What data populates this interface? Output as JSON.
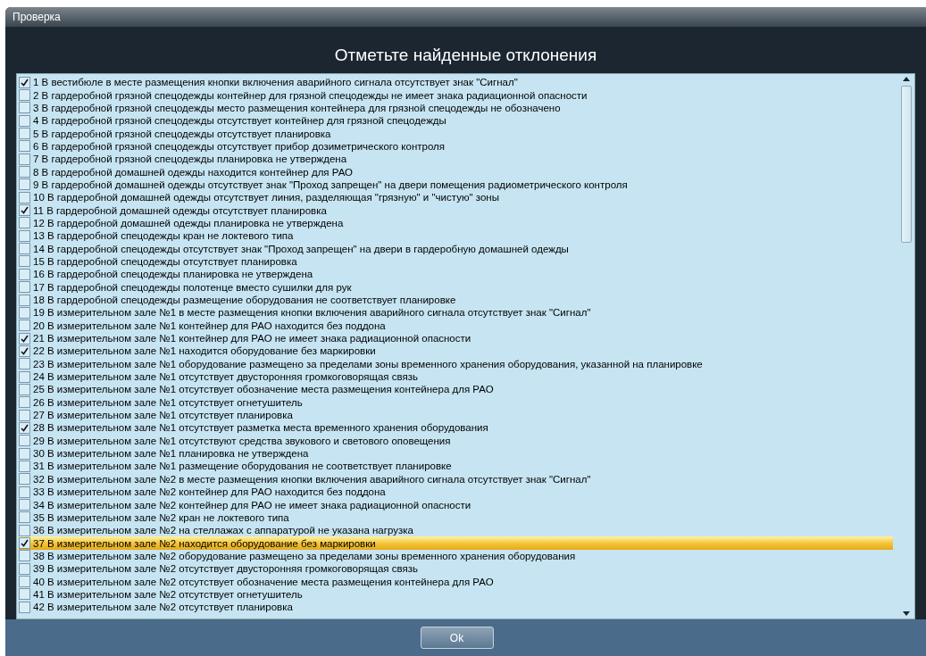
{
  "window": {
    "title": "Проверка"
  },
  "heading": "Отметьте найденные отклонения",
  "items": [
    {
      "label": "1 В вестибюле в месте размещения кнопки включения аварийного сигнала отсутствует знак \"Сигнал\"",
      "checked": true,
      "selected": false
    },
    {
      "label": "2 В гардеробной грязной спецодежды контейнер для грязной спецодежды не имеет знака радиационной опасности",
      "checked": false,
      "selected": false
    },
    {
      "label": "3 В гардеробной грязной спецодежды место размещения контейнера для грязной спецодежды не обозначено",
      "checked": false,
      "selected": false
    },
    {
      "label": "4 В гардеробной грязной спецодежды отсутствует контейнер для грязной спецодежды",
      "checked": false,
      "selected": false
    },
    {
      "label": "5 В гардеробной грязной спецодежды отсутствует планировка",
      "checked": false,
      "selected": false
    },
    {
      "label": "6 В гардеробной грязной спецодежды отсутствует прибор дозиметрического контроля",
      "checked": false,
      "selected": false
    },
    {
      "label": "7 В гардеробной грязной спецодежды планировка не утверждена",
      "checked": false,
      "selected": false
    },
    {
      "label": "8 В гардеробной домашней одежды находится контейнер для РАО",
      "checked": false,
      "selected": false
    },
    {
      "label": "9 В гардеробной домашней одежды отсутствует знак \"Проход запрещен\" на двери помещения радиометрического контроля",
      "checked": false,
      "selected": false
    },
    {
      "label": "10 В гардеробной домашней одежды отсутствует линия, разделяющая \"грязную\" и \"чистую\" зоны",
      "checked": false,
      "selected": false
    },
    {
      "label": "11 В гардеробной домашней одежды отсутствует планировка",
      "checked": true,
      "selected": false
    },
    {
      "label": "12 В гардеробной домашней одежды планировка не утверждена",
      "checked": false,
      "selected": false
    },
    {
      "label": "13 В гардеробной спецодежды кран не локтевого типа",
      "checked": false,
      "selected": false
    },
    {
      "label": "14 В гардеробной спецодежды отсутствует знак \"Проход запрещен\" на двери в гардеробную домашней одежды",
      "checked": false,
      "selected": false
    },
    {
      "label": "15 В гардеробной спецодежды отсутствует планировка",
      "checked": false,
      "selected": false
    },
    {
      "label": "16 В гардеробной спецодежды планировка не утверждена",
      "checked": false,
      "selected": false
    },
    {
      "label": "17 В гардеробной спецодежды полотенце вместо сушилки для рук",
      "checked": false,
      "selected": false
    },
    {
      "label": "18 В гардеробной спецодежды размещение оборудования не соответствует планировке",
      "checked": false,
      "selected": false
    },
    {
      "label": "19 В измерительном зале №1 в месте размещения кнопки включения аварийного сигнала отсутствует знак \"Сигнал\"",
      "checked": false,
      "selected": false
    },
    {
      "label": "20 В измерительном зале №1 контейнер для РАО находится без поддона",
      "checked": false,
      "selected": false
    },
    {
      "label": "21 В измерительном зале №1 контейнер для РАО не имеет знака радиационной опасности",
      "checked": true,
      "selected": false
    },
    {
      "label": "22 В измерительном зале №1 находится оборудование без маркировки",
      "checked": true,
      "selected": false
    },
    {
      "label": "23 В измерительном зале №1 оборудование размещено за пределами зоны временного хранения оборудования, указанной на планировке",
      "checked": false,
      "selected": false
    },
    {
      "label": "24 В измерительном зале №1 отсутствует двусторонняя громкоговорящая связь",
      "checked": false,
      "selected": false
    },
    {
      "label": "25 В измерительном зале №1 отсутствует обозначение места размещения контейнера для РАО",
      "checked": false,
      "selected": false
    },
    {
      "label": "26 В измерительном зале №1 отсутствует огнетушитель",
      "checked": false,
      "selected": false
    },
    {
      "label": "27 В измерительном зале №1 отсутствует планировка",
      "checked": false,
      "selected": false
    },
    {
      "label": "28 В измерительном зале №1 отсутствует разметка места временного хранения оборудования",
      "checked": true,
      "selected": false
    },
    {
      "label": "29 В измерительном зале №1 отсутствуют средства звукового и светового оповещения",
      "checked": false,
      "selected": false
    },
    {
      "label": "30 В измерительном зале №1 планировка не утверждена",
      "checked": false,
      "selected": false
    },
    {
      "label": "31 В измерительном зале №1 размещение оборудования не соответствует планировке",
      "checked": false,
      "selected": false
    },
    {
      "label": "32 В измерительном зале №2 в месте размещения кнопки включения аварийного сигнала отсутствует знак \"Сигнал\"",
      "checked": false,
      "selected": false
    },
    {
      "label": "33 В измерительном зале №2 контейнер для РАО находится без поддона",
      "checked": false,
      "selected": false
    },
    {
      "label": "34 В измерительном зале №2 контейнер для РАО не имеет знака радиационной опасности",
      "checked": false,
      "selected": false
    },
    {
      "label": "35 В измерительном зале №2 кран не локтевого типа",
      "checked": false,
      "selected": false
    },
    {
      "label": "36 В измерительном зале №2 на стеллажах с аппаратурой не указана нагрузка",
      "checked": false,
      "selected": false
    },
    {
      "label": "37 В измерительном зале №2 находится оборудование без маркировки",
      "checked": true,
      "selected": true
    },
    {
      "label": "38 В измерительном зале №2 оборудование размещено за пределами зоны временного хранения оборудования",
      "checked": false,
      "selected": false
    },
    {
      "label": "39 В измерительном зале №2 отсутствует двусторонняя громкоговорящая связь",
      "checked": false,
      "selected": false
    },
    {
      "label": "40 В измерительном зале №2 отсутствует обозначение места размещения контейнера для РАО",
      "checked": false,
      "selected": false
    },
    {
      "label": "41 В измерительном зале №2 отсутствует огнетушитель",
      "checked": false,
      "selected": false
    },
    {
      "label": "42 В измерительном зале №2 отсутствует планировка",
      "checked": false,
      "selected": false
    }
  ],
  "ok_button": "Ok"
}
